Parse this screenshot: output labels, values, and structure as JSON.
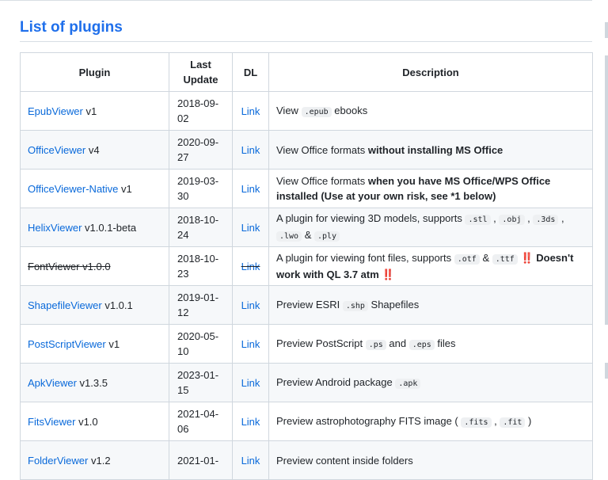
{
  "section": {
    "title": "List of plugins"
  },
  "table": {
    "headers": {
      "plugin": "Plugin",
      "last_update": "Last\nUpdate",
      "dl": "DL",
      "description": "Description"
    },
    "rows": [
      {
        "name": "EpubViewer",
        "version": "v1",
        "date_a": "2018-09-",
        "date_b": "02",
        "dl": "Link",
        "desc": [
          {
            "t": "View "
          },
          {
            "t": ".epub",
            "k": "code"
          },
          {
            "t": " ebooks"
          }
        ]
      },
      {
        "name": "OfficeViewer",
        "version": "v4",
        "date_a": "2020-09-",
        "date_b": "27",
        "dl": "Link",
        "desc": [
          {
            "t": "View Office formats "
          },
          {
            "t": "without installing MS Office",
            "k": "b"
          }
        ]
      },
      {
        "name": "OfficeViewer-Native",
        "version": "v1",
        "date_a": "2019-03-",
        "date_b": "30",
        "dl": "Link",
        "desc": [
          {
            "t": "View Office formats "
          },
          {
            "t": "when you have MS Office/WPS Office installed (Use at your own risk, see *1 below)",
            "k": "b"
          }
        ]
      },
      {
        "name": "HelixViewer",
        "version": "v1.0.1-beta",
        "date_a": "2018-10-",
        "date_b": "24",
        "dl": "Link",
        "desc": [
          {
            "t": "A plugin for viewing 3D models, supports "
          },
          {
            "t": ".stl",
            "k": "code"
          },
          {
            "t": " , "
          },
          {
            "t": ".obj",
            "k": "code"
          },
          {
            "t": " , "
          },
          {
            "t": ".3ds",
            "k": "code"
          },
          {
            "t": " , "
          },
          {
            "t": ".lwo",
            "k": "code"
          },
          {
            "t": " & "
          },
          {
            "t": ".ply",
            "k": "code"
          }
        ]
      },
      {
        "name": "FontViewer",
        "version": "v1.0.0",
        "date_a": "2018-10-",
        "date_b": "23",
        "dl": "Link",
        "struck": true,
        "desc": [
          {
            "t": "A plugin for viewing font files, supports "
          },
          {
            "t": ".otf",
            "k": "code"
          },
          {
            "t": " & "
          },
          {
            "t": ".ttf",
            "k": "code"
          },
          {
            "t": "  "
          },
          {
            "t": "‼️",
            "k": "warn"
          },
          {
            "t": " Doesn't work with QL 3.7 atm ",
            "k": "b"
          },
          {
            "t": "‼️",
            "k": "warn"
          }
        ]
      },
      {
        "name": "ShapefileViewer",
        "version": "v1.0.1",
        "date_a": "2019-01-",
        "date_b": "12",
        "dl": "Link",
        "desc": [
          {
            "t": "Preview ESRI "
          },
          {
            "t": ".shp",
            "k": "code"
          },
          {
            "t": " Shapefiles"
          }
        ]
      },
      {
        "name": "PostScriptViewer",
        "version": "v1",
        "date_a": "2020-05-",
        "date_b": "10",
        "dl": "Link",
        "desc": [
          {
            "t": "Preview PostScript "
          },
          {
            "t": ".ps",
            "k": "code"
          },
          {
            "t": " and "
          },
          {
            "t": ".eps",
            "k": "code"
          },
          {
            "t": " files"
          }
        ]
      },
      {
        "name": "ApkViewer",
        "version": "v1.3.5",
        "date_a": "2023-01-",
        "date_b": "15",
        "dl": "Link",
        "desc": [
          {
            "t": "Preview Android package "
          },
          {
            "t": ".apk",
            "k": "code"
          }
        ]
      },
      {
        "name": "FitsViewer",
        "version": "v1.0",
        "date_a": "2021-04-",
        "date_b": "06",
        "dl": "Link",
        "desc": [
          {
            "t": "Preview astrophotography FITS image ( "
          },
          {
            "t": ".fits",
            "k": "code"
          },
          {
            "t": " , "
          },
          {
            "t": ".fit",
            "k": "code"
          },
          {
            "t": " )"
          }
        ]
      },
      {
        "name": "FolderViewer",
        "version": "v1.2",
        "date_a": "2021-01-",
        "date_b": "",
        "dl": "Link",
        "desc": [
          {
            "t": "Preview content inside folders"
          }
        ]
      }
    ]
  },
  "colors": {
    "link": "#0969da",
    "heading": "#1f6feb",
    "border": "#d0d7de",
    "stripe": "#f6f8fa"
  }
}
